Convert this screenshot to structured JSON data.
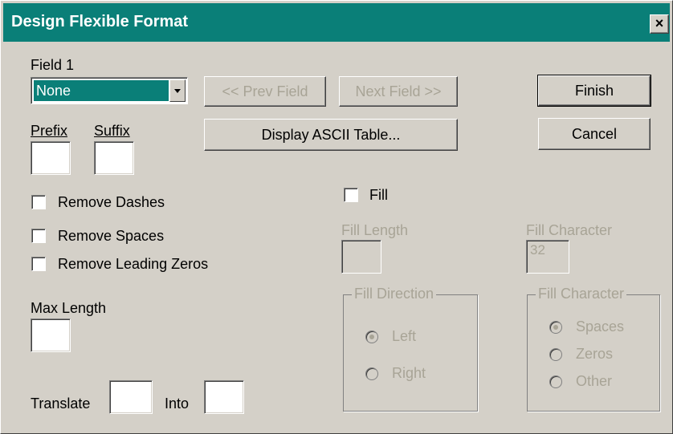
{
  "window": {
    "title": "Design Flexible Format",
    "close_glyph": "×"
  },
  "field": {
    "label": "Field 1",
    "selected": "None"
  },
  "nav": {
    "prev": "<< Prev Field",
    "next": "Next Field >>",
    "ascii": "Display ASCII Table..."
  },
  "actions": {
    "finish": "Finish",
    "cancel": "Cancel"
  },
  "prefix_suffix": {
    "prefix_label": "Prefix",
    "suffix_label": "Suffix",
    "prefix_value": "",
    "suffix_value": ""
  },
  "options": {
    "remove_dashes": {
      "label": "Remove Dashes",
      "checked": false
    },
    "remove_spaces": {
      "label": "Remove Spaces",
      "checked": false
    },
    "remove_leading_zeros": {
      "label": "Remove Leading Zeros",
      "checked": false
    }
  },
  "max_length": {
    "label": "Max Length",
    "value": ""
  },
  "translate": {
    "label": "Translate",
    "into_label": "Into"
  },
  "fill": {
    "label": "Fill",
    "checked": false,
    "length_label": "Fill Length",
    "length_value": "",
    "char_label": "Fill Character",
    "char_value": "32",
    "direction_group": "Fill Direction",
    "direction_options": [
      {
        "label": "Left",
        "checked": true
      },
      {
        "label": "Right",
        "checked": false
      }
    ],
    "char_group": "Fill Character",
    "char_options": [
      {
        "label": "Spaces",
        "checked": true
      },
      {
        "label": "Zeros",
        "checked": false
      },
      {
        "label": "Other",
        "checked": false
      }
    ]
  },
  "colors": {
    "title_bar": "#0a7f78",
    "dialog_bg": "#d4d0c8",
    "disabled_text": "#a8a496"
  }
}
